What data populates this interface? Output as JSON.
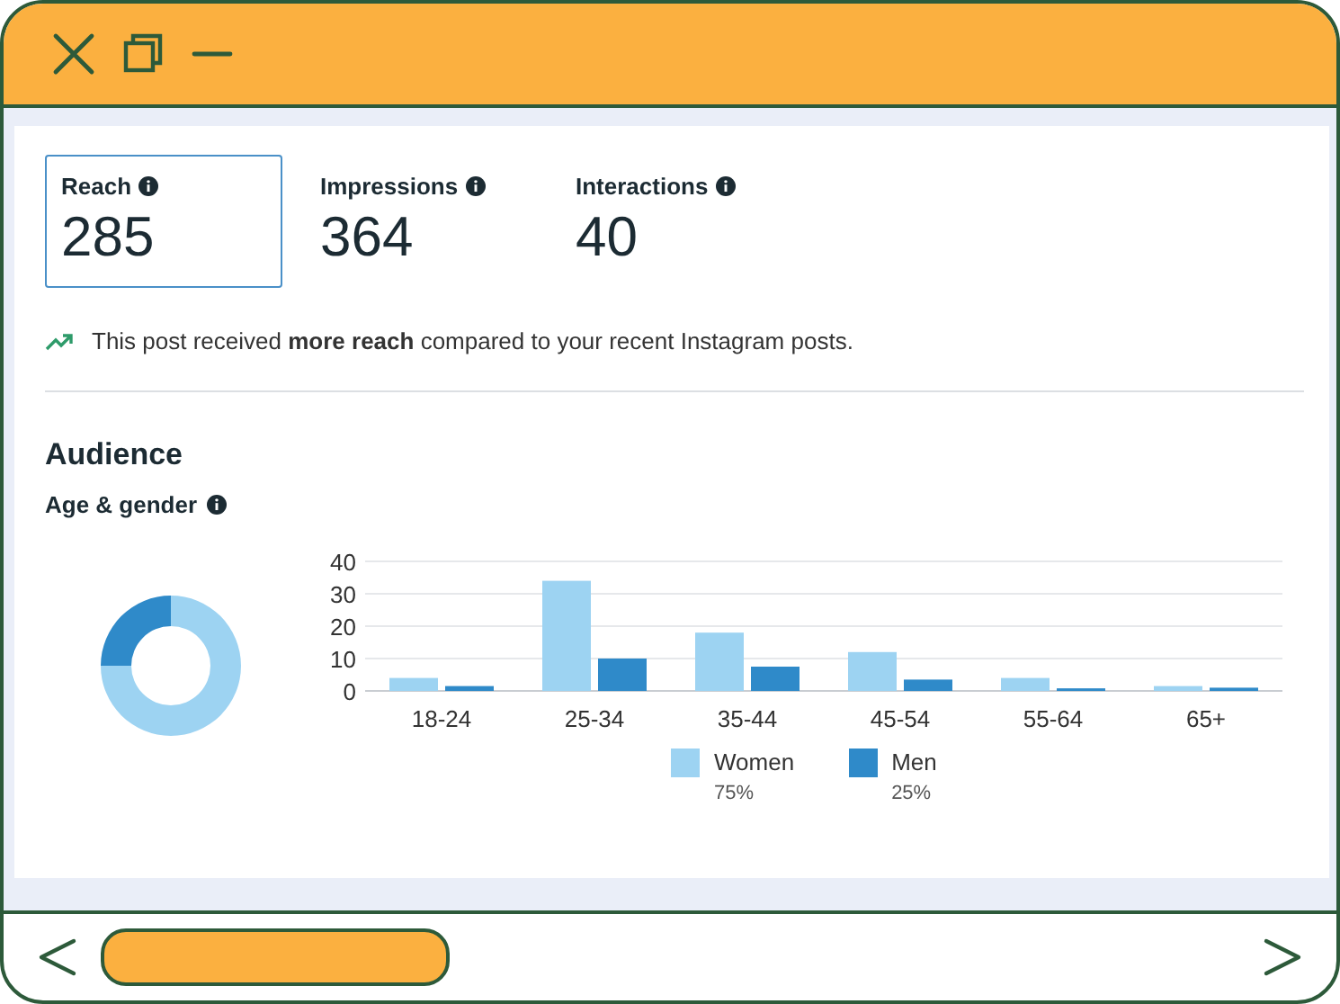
{
  "metrics": [
    {
      "label": "Reach",
      "value": "285",
      "selected": true
    },
    {
      "label": "Impressions",
      "value": "364",
      "selected": false
    },
    {
      "label": "Interactions",
      "value": "40",
      "selected": false
    }
  ],
  "note": "This post received **more reach** compared to your recent Instagram posts.",
  "audience": {
    "title": "Audience",
    "subtitle": "Age & gender",
    "donut": {
      "chart_data": {
        "type": "donut",
        "values": [
          75,
          25
        ],
        "colors": [
          "#9dd3f2",
          "#2f8ac9"
        ]
      }
    },
    "bars": {
      "chart_data": {
        "type": "bar",
        "categories": [
          "18-24",
          "25-34",
          "35-44",
          "45-54",
          "55-64",
          "65+"
        ],
        "yticks": [
          0,
          10,
          20,
          30,
          40
        ],
        "ylim": [
          0,
          40
        ],
        "grid": true,
        "series": [
          {
            "name": "Women",
            "color": "#9dd3f2",
            "values": [
              4,
              34,
              18,
              12,
              4,
              1.5
            ]
          },
          {
            "name": "Men",
            "color": "#2f8ac9",
            "values": [
              1.5,
              10,
              7.5,
              3.5,
              0.8,
              1
            ]
          }
        ]
      }
    },
    "legend_shares": [
      "75%",
      "25%"
    ]
  }
}
